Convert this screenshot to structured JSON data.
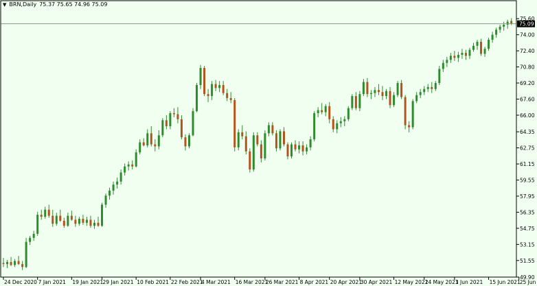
{
  "header": {
    "symbol_label": "BRN,Daily",
    "ohlc_label": "75.37 75.65 74.96 75.09",
    "menu_icon": "triangle-down-icon"
  },
  "colors": {
    "background": "#f0fff0",
    "up_body": "#2e8b2e",
    "down_body": "#b5531c",
    "wick": "#2e8b2e",
    "axis": "#000000",
    "price_line": "#8a9a8a",
    "price_box": "#000000"
  },
  "chart_data": {
    "type": "candlestick",
    "title": "",
    "current_price": 75.09,
    "current_price_label": "75.09",
    "ylim": [
      49.9,
      76.5
    ],
    "y_ticks": [
      75.6,
      74.0,
      72.4,
      70.8,
      69.2,
      67.6,
      66.0,
      64.35,
      62.75,
      61.15,
      59.55,
      57.95,
      56.35,
      54.75,
      53.15,
      51.55,
      49.9
    ],
    "y_tick_labels": [
      "75.60",
      "74.00",
      "72.40",
      "70.80",
      "69.20",
      "67.60",
      "66.00",
      "64.35",
      "62.75",
      "61.15",
      "59.55",
      "57.95",
      "56.35",
      "54.75",
      "53.15",
      "51.55",
      "49.90"
    ],
    "x_tick_labels": [
      {
        "label": "24 Dec 2020",
        "index": 0
      },
      {
        "label": "7 Jan 2021",
        "index": 9
      },
      {
        "label": "19 Jan 2021",
        "index": 18
      },
      {
        "label": "29 Jan 2021",
        "index": 26
      },
      {
        "label": "10 Feb 2021",
        "index": 35
      },
      {
        "label": "22 Feb 2021",
        "index": 44
      },
      {
        "label": "4 Mar 2021",
        "index": 52
      },
      {
        "label": "16 Mar 2021",
        "index": 61
      },
      {
        "label": "26 Mar 2021",
        "index": 69
      },
      {
        "label": "8 Apr 2021",
        "index": 78
      },
      {
        "label": "20 Apr 2021",
        "index": 86
      },
      {
        "label": "30 Apr 2021",
        "index": 94
      },
      {
        "label": "12 May 2021",
        "index": 103
      },
      {
        "label": "24 May 2021",
        "index": 111
      },
      {
        "label": "3 Jun 2021",
        "index": 119
      },
      {
        "label": "15 Jun 2021",
        "index": 128
      },
      {
        "label": "25 Jun 2021",
        "index": 136
      }
    ],
    "candles": [
      [
        51.3,
        51.8,
        50.9,
        51.2
      ],
      [
        51.2,
        51.6,
        50.8,
        51.4
      ],
      [
        51.4,
        51.9,
        51.0,
        51.1
      ],
      [
        51.1,
        51.7,
        50.9,
        51.5
      ],
      [
        51.5,
        52.0,
        51.1,
        51.2
      ],
      [
        51.2,
        51.5,
        50.6,
        50.9
      ],
      [
        50.9,
        53.8,
        50.8,
        53.4
      ],
      [
        53.4,
        54.0,
        53.1,
        53.8
      ],
      [
        53.8,
        54.5,
        53.5,
        54.2
      ],
      [
        54.2,
        56.4,
        54.0,
        56.1
      ],
      [
        56.1,
        56.6,
        55.6,
        55.9
      ],
      [
        55.9,
        56.9,
        55.7,
        56.6
      ],
      [
        56.6,
        57.1,
        55.8,
        56.0
      ],
      [
        56.0,
        56.6,
        54.9,
        55.2
      ],
      [
        55.2,
        56.3,
        55.0,
        56.0
      ],
      [
        56.0,
        56.6,
        55.4,
        55.5
      ],
      [
        55.5,
        55.8,
        54.8,
        55.0
      ],
      [
        55.0,
        56.3,
        54.9,
        56.0
      ],
      [
        56.0,
        56.5,
        55.5,
        55.6
      ],
      [
        55.6,
        56.0,
        54.9,
        55.2
      ],
      [
        55.2,
        55.9,
        55.0,
        55.7
      ],
      [
        55.7,
        56.1,
        55.1,
        55.3
      ],
      [
        55.3,
        55.9,
        55.0,
        55.6
      ],
      [
        55.6,
        56.0,
        54.8,
        55.0
      ],
      [
        55.0,
        55.6,
        54.7,
        55.3
      ],
      [
        55.3,
        55.9,
        54.9,
        55.0
      ],
      [
        55.0,
        57.3,
        54.9,
        57.1
      ],
      [
        57.1,
        58.2,
        56.8,
        58.0
      ],
      [
        58.0,
        58.8,
        57.6,
        58.5
      ],
      [
        58.5,
        59.4,
        58.1,
        59.1
      ],
      [
        59.1,
        59.8,
        58.7,
        59.4
      ],
      [
        59.4,
        60.6,
        59.1,
        60.3
      ],
      [
        60.3,
        61.2,
        60.0,
        60.9
      ],
      [
        60.9,
        61.4,
        60.5,
        61.1
      ],
      [
        61.1,
        61.5,
        60.6,
        60.9
      ],
      [
        60.9,
        62.6,
        60.8,
        62.3
      ],
      [
        62.3,
        63.6,
        62.1,
        63.3
      ],
      [
        63.3,
        63.7,
        62.9,
        63.0
      ],
      [
        63.0,
        64.6,
        62.8,
        64.2
      ],
      [
        64.2,
        64.9,
        62.9,
        63.1
      ],
      [
        63.1,
        63.6,
        62.4,
        62.9
      ],
      [
        62.9,
        64.5,
        62.6,
        64.0
      ],
      [
        64.0,
        65.7,
        63.8,
        65.5
      ],
      [
        65.5,
        66.0,
        64.6,
        64.9
      ],
      [
        64.9,
        66.4,
        64.6,
        66.2
      ],
      [
        66.2,
        66.7,
        65.8,
        66.1
      ],
      [
        66.1,
        66.8,
        65.2,
        65.6
      ],
      [
        65.6,
        66.0,
        63.6,
        63.8
      ],
      [
        63.8,
        64.1,
        62.5,
        62.9
      ],
      [
        62.9,
        64.2,
        62.7,
        64.0
      ],
      [
        64.0,
        66.7,
        63.9,
        66.4
      ],
      [
        66.4,
        69.2,
        66.3,
        69.0
      ],
      [
        69.0,
        71.0,
        68.6,
        70.7
      ],
      [
        70.7,
        70.9,
        67.9,
        68.1
      ],
      [
        68.1,
        68.6,
        67.3,
        67.9
      ],
      [
        67.9,
        69.4,
        67.5,
        69.1
      ],
      [
        69.1,
        69.5,
        68.4,
        68.7
      ],
      [
        68.7,
        69.4,
        68.3,
        69.0
      ],
      [
        69.0,
        69.4,
        68.0,
        68.2
      ],
      [
        68.2,
        68.6,
        67.4,
        67.7
      ],
      [
        67.7,
        68.3,
        67.2,
        67.5
      ],
      [
        67.5,
        67.7,
        62.4,
        62.8
      ],
      [
        62.8,
        64.6,
        62.5,
        64.3
      ],
      [
        64.3,
        65.0,
        63.6,
        63.9
      ],
      [
        63.9,
        64.4,
        62.1,
        62.4
      ],
      [
        62.4,
        62.7,
        60.3,
        60.6
      ],
      [
        60.6,
        64.3,
        60.4,
        64.0
      ],
      [
        64.0,
        64.3,
        62.9,
        63.1
      ],
      [
        63.1,
        63.5,
        61.3,
        61.7
      ],
      [
        61.7,
        64.5,
        61.5,
        64.2
      ],
      [
        64.2,
        65.3,
        63.9,
        65.0
      ],
      [
        65.0,
        65.3,
        64.0,
        64.2
      ],
      [
        64.2,
        64.5,
        62.4,
        62.7
      ],
      [
        62.7,
        64.6,
        62.5,
        64.4
      ],
      [
        64.4,
        64.8,
        62.9,
        63.1
      ],
      [
        63.1,
        63.3,
        61.6,
        61.9
      ],
      [
        61.9,
        63.3,
        61.7,
        63.1
      ],
      [
        63.1,
        63.5,
        62.4,
        62.6
      ],
      [
        62.6,
        63.4,
        62.2,
        63.0
      ],
      [
        63.0,
        63.4,
        62.0,
        62.4
      ],
      [
        62.4,
        63.1,
        62.1,
        62.8
      ],
      [
        62.8,
        63.9,
        62.5,
        63.6
      ],
      [
        63.6,
        66.4,
        63.4,
        66.2
      ],
      [
        66.2,
        66.8,
        65.8,
        66.5
      ],
      [
        66.5,
        67.2,
        66.1,
        66.3
      ],
      [
        66.3,
        67.1,
        65.9,
        66.9
      ],
      [
        66.9,
        67.3,
        65.2,
        65.6
      ],
      [
        65.6,
        65.9,
        64.3,
        64.6
      ],
      [
        64.6,
        65.5,
        64.2,
        65.2
      ],
      [
        65.2,
        65.8,
        64.8,
        65.4
      ],
      [
        65.4,
        65.9,
        64.9,
        65.6
      ],
      [
        65.6,
        66.9,
        65.4,
        66.7
      ],
      [
        66.7,
        68.1,
        66.5,
        67.9
      ],
      [
        67.9,
        68.3,
        66.5,
        66.7
      ],
      [
        66.7,
        68.4,
        66.4,
        68.1
      ],
      [
        68.1,
        69.6,
        67.9,
        69.3
      ],
      [
        69.3,
        69.7,
        67.8,
        68.1
      ],
      [
        68.1,
        68.5,
        67.6,
        68.2
      ],
      [
        68.2,
        68.8,
        67.8,
        68.5
      ],
      [
        68.5,
        69.1,
        68.0,
        68.3
      ],
      [
        68.3,
        68.9,
        67.5,
        67.9
      ],
      [
        67.9,
        68.6,
        67.6,
        68.4
      ],
      [
        68.4,
        68.8,
        66.7,
        67.0
      ],
      [
        67.0,
        68.3,
        66.8,
        68.0
      ],
      [
        68.0,
        69.4,
        67.8,
        69.2
      ],
      [
        69.2,
        69.5,
        67.6,
        67.8
      ],
      [
        67.8,
        68.0,
        64.6,
        65.0
      ],
      [
        65.0,
        65.4,
        64.3,
        64.8
      ],
      [
        64.8,
        67.6,
        64.6,
        67.4
      ],
      [
        67.4,
        68.3,
        67.2,
        68.0
      ],
      [
        68.0,
        68.6,
        67.7,
        68.3
      ],
      [
        68.3,
        68.9,
        68.0,
        68.6
      ],
      [
        68.6,
        69.1,
        68.3,
        68.8
      ],
      [
        68.8,
        69.3,
        68.2,
        68.6
      ],
      [
        68.6,
        69.4,
        68.4,
        69.2
      ],
      [
        69.2,
        70.9,
        69.0,
        70.6
      ],
      [
        70.6,
        71.5,
        70.3,
        71.2
      ],
      [
        71.2,
        71.8,
        70.8,
        71.5
      ],
      [
        71.5,
        72.2,
        71.2,
        71.9
      ],
      [
        71.9,
        72.4,
        71.4,
        71.7
      ],
      [
        71.7,
        72.3,
        71.3,
        72.0
      ],
      [
        72.0,
        72.6,
        71.6,
        72.2
      ],
      [
        72.2,
        72.5,
        71.5,
        71.9
      ],
      [
        71.9,
        72.7,
        71.6,
        72.5
      ],
      [
        72.5,
        73.2,
        72.3,
        72.9
      ],
      [
        72.9,
        73.5,
        72.5,
        73.3
      ],
      [
        73.3,
        73.6,
        71.9,
        72.1
      ],
      [
        72.1,
        72.8,
        71.8,
        72.6
      ],
      [
        72.6,
        73.7,
        72.4,
        73.5
      ],
      [
        73.5,
        74.3,
        73.2,
        74.0
      ],
      [
        74.0,
        74.7,
        73.7,
        74.5
      ],
      [
        74.5,
        75.0,
        74.2,
        74.8
      ],
      [
        74.8,
        75.3,
        74.4,
        75.0
      ],
      [
        75.0,
        75.5,
        74.6,
        75.3
      ],
      [
        75.37,
        75.65,
        74.96,
        75.09
      ]
    ]
  }
}
